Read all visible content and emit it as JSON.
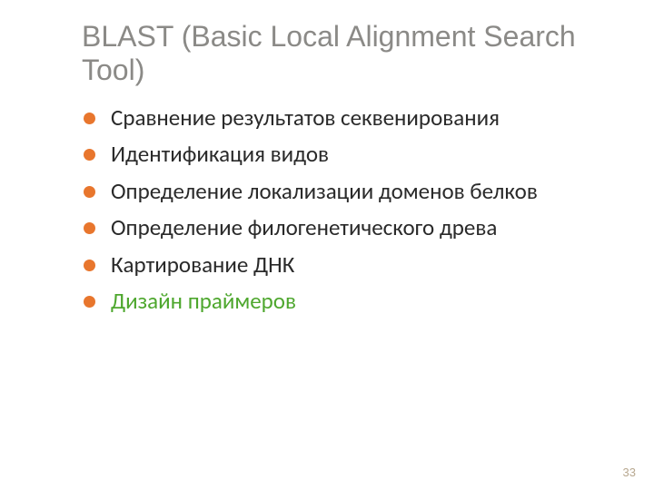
{
  "title": "BLAST (Basic Local Alignment Search Tool)",
  "bullets": {
    "item0": "Сравнение результатов секвенирования",
    "item1": "Идентификация видов",
    "item2": "Определение локализации доменов белков",
    "item3": "Определение филогенетического древа",
    "item4": "Картирование ДНК",
    "item5": "Дизайн праймеров"
  },
  "page_number": "33",
  "colors": {
    "title": "#8b8a87",
    "bullet_dot": "#e8762d",
    "highlight": "#4ea72e",
    "page_num": "#b8a890"
  }
}
